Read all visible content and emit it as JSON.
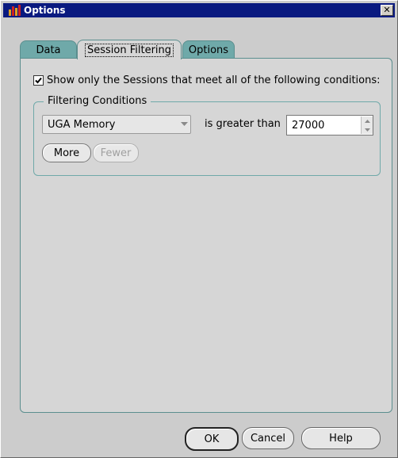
{
  "window": {
    "title": "Options"
  },
  "tabs": [
    {
      "label": "Data"
    },
    {
      "label": "Session Filtering"
    },
    {
      "label": "Options"
    }
  ],
  "active_tab": "Session Filtering",
  "filter": {
    "checkbox_label": "Show only the Sessions that meet all of the following conditions:",
    "checked": true,
    "group_label": "Filtering Conditions",
    "condition": {
      "field": "UGA Memory",
      "operator": "is greater than",
      "value": "27000"
    },
    "more_label": "More",
    "fewer_label": "Fewer"
  },
  "footer": {
    "ok_label": "OK",
    "cancel_label": "Cancel",
    "help_label": "Help"
  },
  "colors": {
    "titlebar": "#0a1a80",
    "tab_inactive": "#6fa9a9",
    "panel": "#d6d6d6"
  }
}
